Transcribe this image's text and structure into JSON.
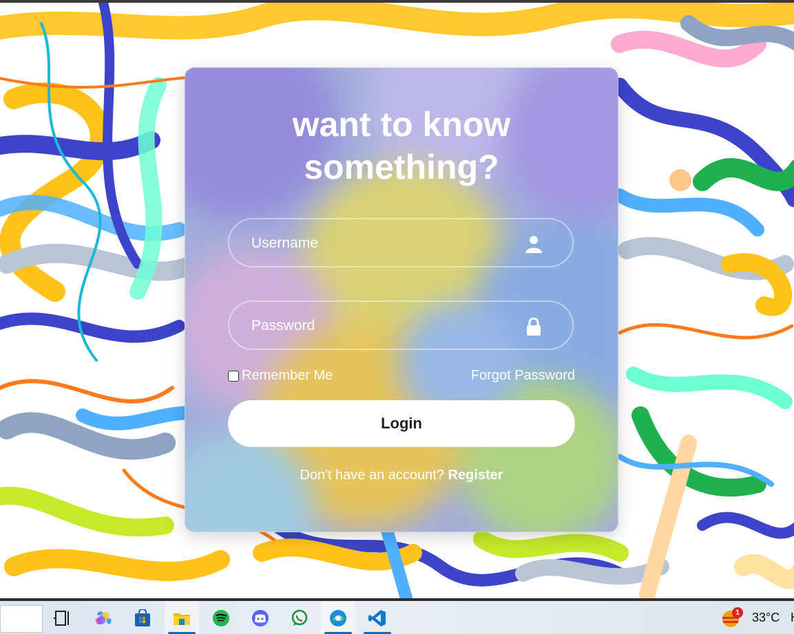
{
  "login": {
    "title_line1": "want to know",
    "title_line2": "something?",
    "username_placeholder": "Username",
    "password_placeholder": "Password",
    "remember_label": "Remember Me",
    "forgot_label": "Forgot Password",
    "login_label": "Login",
    "register_prompt": "Don't have an account?",
    "register_link": "Register"
  },
  "taskbar": {
    "apps": [
      "task-view",
      "copilot",
      "microsoft-store",
      "file-explorer",
      "spotify",
      "discord",
      "whatsapp",
      "edge",
      "vscode"
    ],
    "weather_badge": "1",
    "temperature": "33°C",
    "overflow_text": "H"
  },
  "colors": {
    "card_text": "#ffffff",
    "login_button_bg": "#ffffff",
    "login_button_text": "#222222",
    "taskbar_accent": "#0f6cbd"
  }
}
